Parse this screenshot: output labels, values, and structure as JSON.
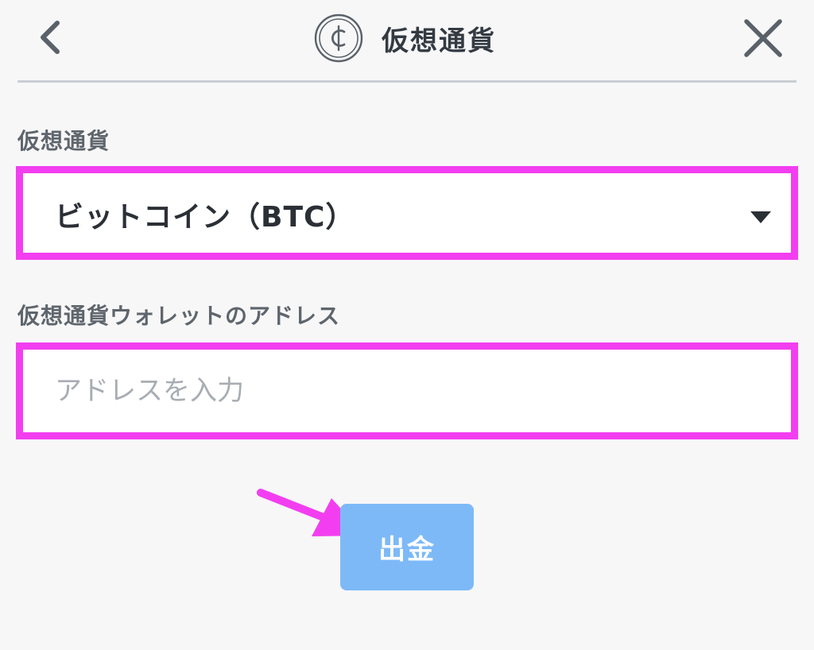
{
  "header": {
    "title": "仮想通貨",
    "back_icon": "chevron-left-icon",
    "close_icon": "close-icon",
    "coin_icon": "cent-coin-icon"
  },
  "form": {
    "currency_label": "仮想通貨",
    "currency_selected": "ビットコイン（BTC）",
    "address_label": "仮想通貨ウォレットのアドレス",
    "address_placeholder": "アドレスを入力",
    "address_value": ""
  },
  "actions": {
    "withdraw_label": "出金"
  },
  "colors": {
    "highlight": "#f23ef0",
    "button_bg": "#7db9f7",
    "background": "#f7f7f8",
    "divider": "#c9cdd2"
  }
}
